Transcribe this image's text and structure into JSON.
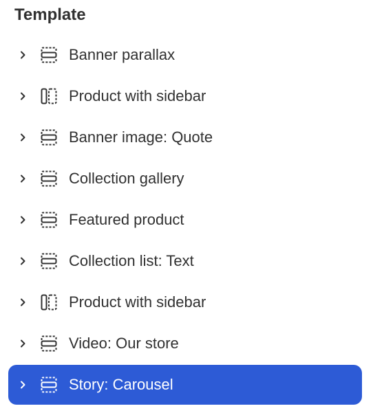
{
  "panel": {
    "title": "Template"
  },
  "sections": [
    {
      "label": "Banner parallax",
      "icon": "banner-section-icon",
      "selected": false
    },
    {
      "label": "Product with sidebar",
      "icon": "sidebar-section-icon",
      "selected": false
    },
    {
      "label": "Banner image: Quote",
      "icon": "banner-section-icon",
      "selected": false
    },
    {
      "label": "Collection gallery",
      "icon": "banner-section-icon",
      "selected": false
    },
    {
      "label": "Featured product",
      "icon": "banner-section-icon",
      "selected": false
    },
    {
      "label": "Collection list: Text",
      "icon": "banner-section-icon",
      "selected": false
    },
    {
      "label": "Product with sidebar",
      "icon": "sidebar-section-icon",
      "selected": false
    },
    {
      "label": "Video: Our store",
      "icon": "banner-section-icon",
      "selected": false
    },
    {
      "label": "Story: Carousel",
      "icon": "banner-section-icon",
      "selected": true
    }
  ],
  "colors": {
    "text": "#303030",
    "selected_background": "#2d5bd6",
    "selected_text": "#ffffff"
  }
}
